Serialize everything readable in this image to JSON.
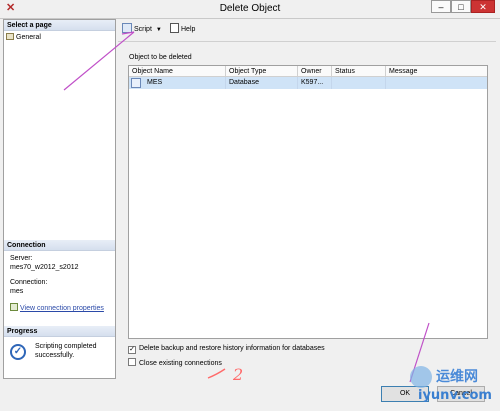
{
  "window": {
    "title": "Delete Object",
    "min_glyph": "–",
    "max_glyph": "□",
    "close_glyph": "✕",
    "app_icon_glyph": "✕"
  },
  "left": {
    "select_page_header": "Select a page",
    "pages": [
      {
        "label": "General",
        "icon": "page-icon"
      }
    ],
    "connection_header": "Connection",
    "server_label": "Server:",
    "server_value": "mes70_w2012_s2012",
    "connection_label": "Connection:",
    "connection_value": "mes",
    "view_connection_properties": "View connection properties",
    "progress_header": "Progress",
    "progress_text_line1": "Scripting completed",
    "progress_text_line2": "successfully.",
    "progress_icon": "check-circle-icon"
  },
  "toolbar": {
    "script_label": "Script",
    "help_label": "Help"
  },
  "main": {
    "objects_label": "Object to be deleted",
    "columns": [
      "Object Name",
      "Object Type",
      "Owner",
      "Status",
      "Message"
    ],
    "rows": [
      {
        "object_name": "MES",
        "object_type": "Database",
        "owner": "K597...",
        "status": "",
        "message": ""
      }
    ],
    "option_delete_backup": {
      "label": "Delete backup and restore history information for databases",
      "checked": true
    },
    "option_close_connections": {
      "label": "Close existing connections",
      "checked": false
    }
  },
  "buttons": {
    "ok": "OK",
    "cancel": "Cancel"
  },
  "annotations": {
    "handwritten_number": "2",
    "watermark_text": "运维网",
    "watermark_url": "iyunv.com",
    "pen_color": "#c050c8"
  },
  "colors": {
    "selection": "#cfe3f7",
    "link": "#2b4aa8"
  }
}
